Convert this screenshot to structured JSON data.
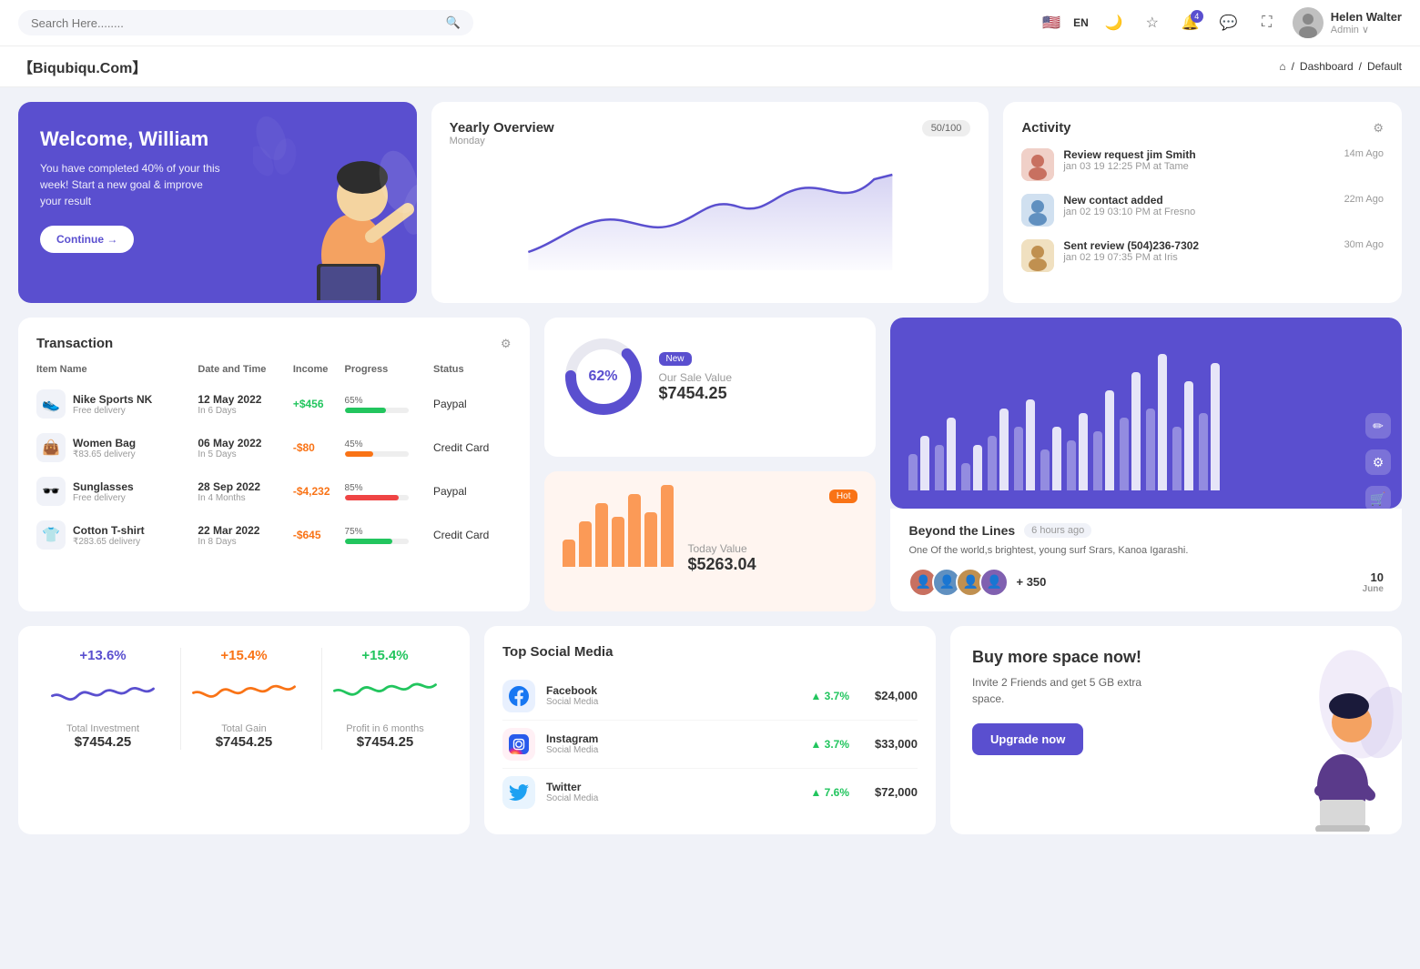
{
  "topnav": {
    "search_placeholder": "Search Here........",
    "lang": "EN",
    "user_name": "Helen Walter",
    "user_role": "Admin ∨"
  },
  "breadcrumb": {
    "brand": "【Biqubiqu.Com】",
    "home": "⌂",
    "path": [
      "Dashboard",
      "Default"
    ]
  },
  "welcome": {
    "title": "Welcome, William",
    "desc": "You have completed 40% of your this week! Start a new goal & improve your result",
    "button": "Continue →"
  },
  "overview": {
    "title": "Yearly Overview",
    "subtitle": "Monday",
    "badge": "50/100"
  },
  "activity": {
    "title": "Activity",
    "items": [
      {
        "name": "Review request jim Smith",
        "time_text": "jan 03 19 12:25 PM at Tame",
        "time_ago": "14m Ago"
      },
      {
        "name": "New contact added",
        "time_text": "jan 02 19 03:10 PM at Fresno",
        "time_ago": "22m Ago"
      },
      {
        "name": "Sent review (504)236-7302",
        "time_text": "jan 02 19 07:35 PM at Iris",
        "time_ago": "30m Ago"
      }
    ]
  },
  "transaction": {
    "title": "Transaction",
    "columns": [
      "Item Name",
      "Date and Time",
      "Income",
      "Progress",
      "Status"
    ],
    "rows": [
      {
        "name": "Nike Sports NK",
        "sub": "Free delivery",
        "date": "12 May 2022",
        "date_sub": "In 6 Days",
        "income": "+$456",
        "income_type": "pos",
        "progress": 65,
        "progress_color": "#22c55e",
        "status": "Paypal",
        "icon": "👟"
      },
      {
        "name": "Women Bag",
        "sub": "₹83.65 delivery",
        "date": "06 May 2022",
        "date_sub": "In 5 Days",
        "income": "-$80",
        "income_type": "neg",
        "progress": 45,
        "progress_color": "#f97316",
        "status": "Credit Card",
        "icon": "👜"
      },
      {
        "name": "Sunglasses",
        "sub": "Free delivery",
        "date": "28 Sep 2022",
        "date_sub": "In 4 Months",
        "income": "-$4,232",
        "income_type": "neg",
        "progress": 85,
        "progress_color": "#ef4444",
        "status": "Paypal",
        "icon": "🕶️"
      },
      {
        "name": "Cotton T-shirt",
        "sub": "₹283.65 delivery",
        "date": "22 Mar 2022",
        "date_sub": "In 8 Days",
        "income": "-$645",
        "income_type": "neg",
        "progress": 75,
        "progress_color": "#22c55e",
        "status": "Credit Card",
        "icon": "👕"
      }
    ]
  },
  "sale": {
    "donut_pct": "62%",
    "label": "Our Sale Value",
    "value": "$7454.25",
    "tag": "New"
  },
  "today": {
    "label": "Today Value",
    "value": "$5263.04",
    "tag": "Hot",
    "bars": [
      30,
      50,
      70,
      55,
      80,
      60,
      90
    ]
  },
  "beyond": {
    "title": "Beyond the Lines",
    "time_ago": "6 hours ago",
    "desc": "One Of the world,s brightest, young surf Srars, Kanoa Igarashi.",
    "count": "+ 350",
    "date": "10",
    "date_sub": "June"
  },
  "metrics": [
    {
      "pct": "+13.6%",
      "color": "purple",
      "label": "Total Investment",
      "value": "$7454.25"
    },
    {
      "pct": "+15.4%",
      "color": "orange",
      "label": "Total Gain",
      "value": "$7454.25"
    },
    {
      "pct": "+15.4%",
      "color": "green",
      "label": "Profit in 6 months",
      "value": "$7454.25"
    }
  ],
  "social": {
    "title": "Top Social Media",
    "items": [
      {
        "name": "Facebook",
        "sub": "Social Media",
        "pct": "3.7%",
        "amount": "$24,000",
        "icon": "f",
        "color": "#1877f2"
      },
      {
        "name": "Instagram",
        "sub": "Social Media",
        "pct": "3.7%",
        "amount": "$33,000",
        "icon": "📷",
        "color": "#e1306c"
      },
      {
        "name": "Twitter",
        "sub": "Social Media",
        "pct": "7.6%",
        "amount": "$72,000",
        "icon": "🐦",
        "color": "#1da1f2"
      }
    ]
  },
  "upgrade": {
    "title": "Buy more space now!",
    "desc": "Invite 2 Friends and get 5 GB extra space.",
    "button": "Upgrade now"
  },
  "chart_bars": [
    [
      40,
      60
    ],
    [
      50,
      80
    ],
    [
      30,
      50
    ],
    [
      60,
      90
    ],
    [
      70,
      100
    ],
    [
      45,
      70
    ],
    [
      55,
      85
    ],
    [
      65,
      110
    ],
    [
      80,
      130
    ],
    [
      90,
      150
    ],
    [
      70,
      120
    ],
    [
      85,
      140
    ]
  ]
}
